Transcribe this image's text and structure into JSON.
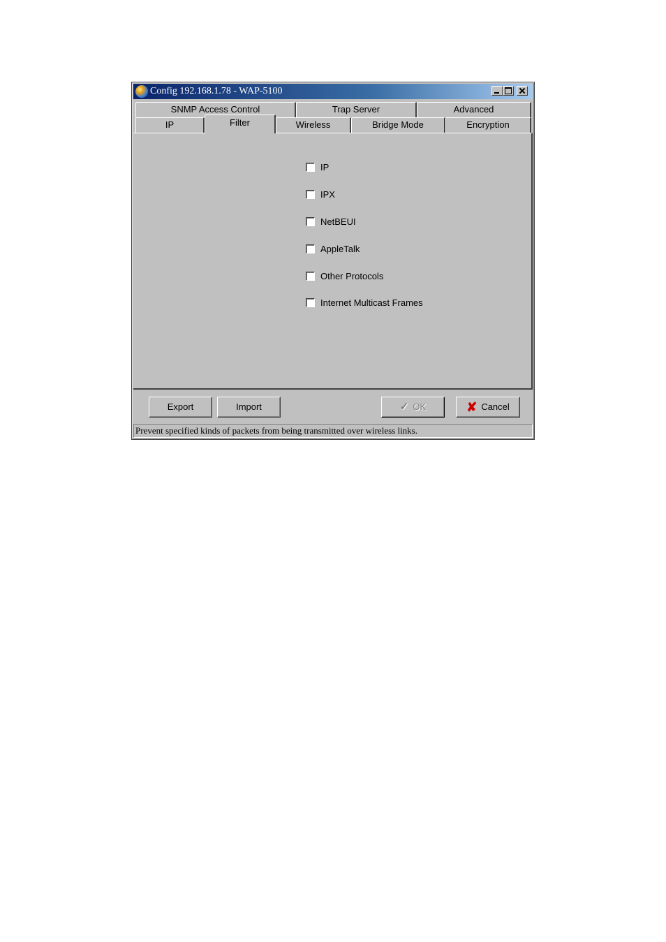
{
  "window": {
    "title": "Config 192.168.1.78 - WAP-5100"
  },
  "tabs": {
    "back_row": [
      {
        "label": "SNMP Access Control"
      },
      {
        "label": "Trap Server"
      },
      {
        "label": "Advanced"
      }
    ],
    "front_row": [
      {
        "label": "IP"
      },
      {
        "label": "Filter",
        "active": true
      },
      {
        "label": "Wireless"
      },
      {
        "label": "Bridge Mode"
      },
      {
        "label": "Encryption"
      }
    ]
  },
  "filter": {
    "options": [
      {
        "label": "IP",
        "checked": false
      },
      {
        "label": "IPX",
        "checked": false
      },
      {
        "label": "NetBEUI",
        "checked": false
      },
      {
        "label": "AppleTalk",
        "checked": false
      },
      {
        "label": "Other Protocols",
        "checked": false
      },
      {
        "label": "Internet Multicast Frames",
        "checked": false
      }
    ]
  },
  "buttons": {
    "export": "Export",
    "import": "Import",
    "ok": "OK",
    "cancel": "Cancel"
  },
  "icons": {
    "ok": "checkmark-icon",
    "cancel": "red-x-icon"
  },
  "colors": {
    "window_bg": "#c0c0c0",
    "titlebar_start": "#0a246a",
    "titlebar_end": "#a6caf0",
    "cancel_icon": "#cc0000"
  },
  "status": {
    "text": "Prevent specified kinds of packets from being transmitted over wireless links."
  }
}
